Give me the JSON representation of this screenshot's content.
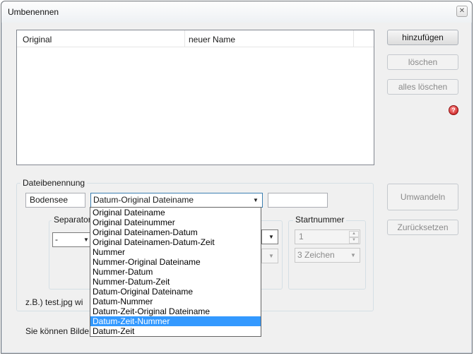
{
  "window": {
    "title": "Umbenennen",
    "close_glyph": "✕"
  },
  "list": {
    "columns": [
      "Original",
      "neuer Name"
    ]
  },
  "buttons": {
    "add": "hinzufügen",
    "delete": "löschen",
    "delete_all": "alles löschen",
    "convert": "Umwandeln",
    "reset": "Zurücksetzen"
  },
  "naming": {
    "group_label": "Dateibenennung",
    "name_value": "Bodensee",
    "scheme_value": "Datum-Original Dateiname",
    "suffix_value": "",
    "separator_label": "Separator",
    "separator_value": "-",
    "startnumber_label": "Startnummer",
    "startnumber_value": "1",
    "digits_value": "3 Zeichen",
    "example_text": "z.B.) test.jpg wi",
    "info_text": "Sie können Bilde"
  },
  "dropdown": {
    "options": [
      "Original Dateiname",
      "Original Dateinummer",
      "Original Dateinamen-Datum",
      "Original Dateinamen-Datum-Zeit",
      "Nummer",
      "Nummer-Original Dateiname",
      "Nummer-Datum",
      "Nummer-Datum-Zeit",
      "Datum-Original Dateiname",
      "Datum-Nummer",
      "Datum-Zeit-Original Dateiname",
      "Datum-Zeit-Nummer",
      "Datum-Zeit"
    ],
    "highlighted": "Datum-Zeit-Nummer"
  },
  "icons": {
    "help": "help-icon",
    "dropdown_arrow": "▼",
    "spin_up": "▲",
    "spin_down": "▼"
  }
}
